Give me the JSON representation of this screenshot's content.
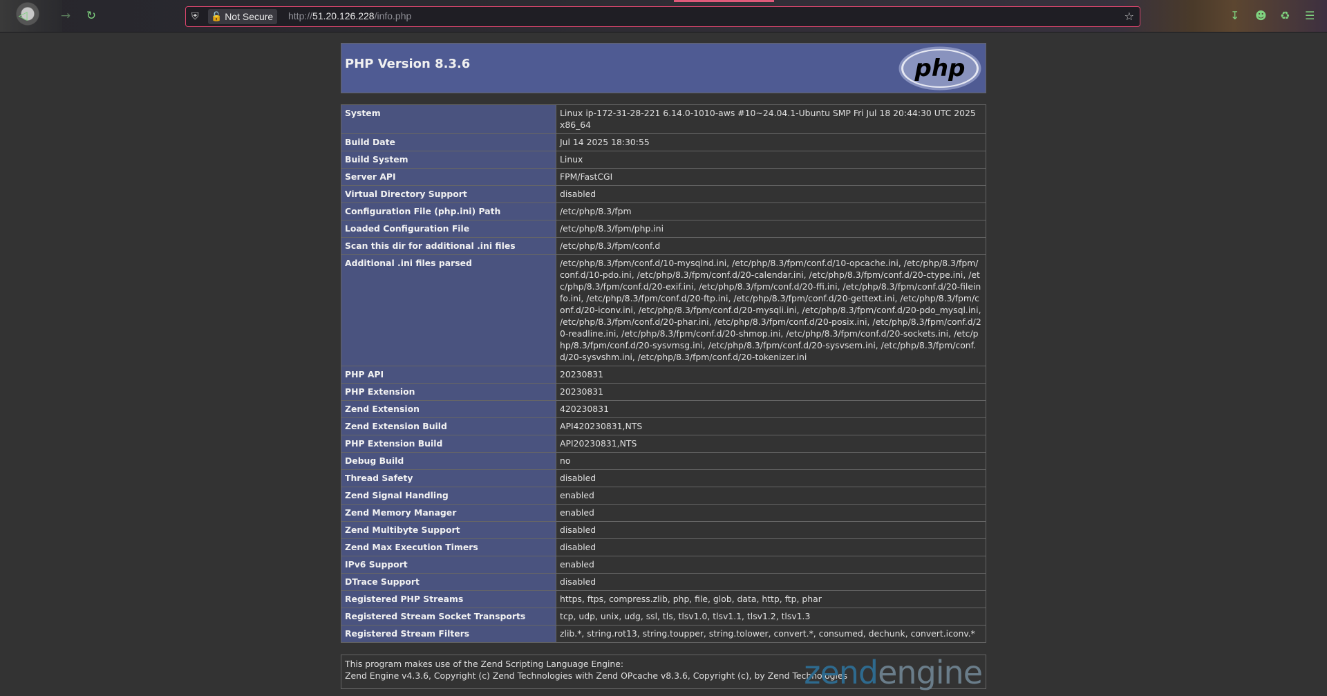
{
  "browser": {
    "security_label": "Not Secure",
    "url_scheme": "http://",
    "url_host": "51.20.126.228",
    "url_path": "/info.php"
  },
  "header": {
    "title": "PHP Version 8.3.6",
    "logo_text": "php"
  },
  "rows": [
    {
      "key": "System",
      "value": "Linux ip-172-31-28-221 6.14.0-1010-aws #10~24.04.1-Ubuntu SMP Fri Jul 18 20:44:30 UTC 2025 x86_64"
    },
    {
      "key": "Build Date",
      "value": "Jul 14 2025 18:30:55"
    },
    {
      "key": "Build System",
      "value": "Linux"
    },
    {
      "key": "Server API",
      "value": "FPM/FastCGI"
    },
    {
      "key": "Virtual Directory Support",
      "value": "disabled"
    },
    {
      "key": "Configuration File (php.ini) Path",
      "value": "/etc/php/8.3/fpm"
    },
    {
      "key": "Loaded Configuration File",
      "value": "/etc/php/8.3/fpm/php.ini"
    },
    {
      "key": "Scan this dir for additional .ini files",
      "value": "/etc/php/8.3/fpm/conf.d"
    },
    {
      "key": "Additional .ini files parsed",
      "value": "/etc/php/8.3/fpm/conf.d/10-mysqlnd.ini, /etc/php/8.3/fpm/conf.d/10-opcache.ini, /etc/php/8.3/fpm/conf.d/10-pdo.ini, /etc/php/8.3/fpm/conf.d/20-calendar.ini, /etc/php/8.3/fpm/conf.d/20-ctype.ini, /etc/php/8.3/fpm/conf.d/20-exif.ini, /etc/php/8.3/fpm/conf.d/20-ffi.ini, /etc/php/8.3/fpm/conf.d/20-fileinfo.ini, /etc/php/8.3/fpm/conf.d/20-ftp.ini, /etc/php/8.3/fpm/conf.d/20-gettext.ini, /etc/php/8.3/fpm/conf.d/20-iconv.ini, /etc/php/8.3/fpm/conf.d/20-mysqli.ini, /etc/php/8.3/fpm/conf.d/20-pdo_mysql.ini, /etc/php/8.3/fpm/conf.d/20-phar.ini, /etc/php/8.3/fpm/conf.d/20-posix.ini, /etc/php/8.3/fpm/conf.d/20-readline.ini, /etc/php/8.3/fpm/conf.d/20-shmop.ini, /etc/php/8.3/fpm/conf.d/20-sockets.ini, /etc/php/8.3/fpm/conf.d/20-sysvmsg.ini, /etc/php/8.3/fpm/conf.d/20-sysvsem.ini, /etc/php/8.3/fpm/conf.d/20-sysvshm.ini, /etc/php/8.3/fpm/conf.d/20-tokenizer.ini"
    },
    {
      "key": "PHP API",
      "value": "20230831"
    },
    {
      "key": "PHP Extension",
      "value": "20230831"
    },
    {
      "key": "Zend Extension",
      "value": "420230831"
    },
    {
      "key": "Zend Extension Build",
      "value": "API420230831,NTS"
    },
    {
      "key": "PHP Extension Build",
      "value": "API20230831,NTS"
    },
    {
      "key": "Debug Build",
      "value": "no"
    },
    {
      "key": "Thread Safety",
      "value": "disabled"
    },
    {
      "key": "Zend Signal Handling",
      "value": "enabled"
    },
    {
      "key": "Zend Memory Manager",
      "value": "enabled"
    },
    {
      "key": "Zend Multibyte Support",
      "value": "disabled"
    },
    {
      "key": "Zend Max Execution Timers",
      "value": "disabled"
    },
    {
      "key": "IPv6 Support",
      "value": "enabled"
    },
    {
      "key": "DTrace Support",
      "value": "disabled"
    },
    {
      "key": "Registered PHP Streams",
      "value": "https, ftps, compress.zlib, php, file, glob, data, http, ftp, phar"
    },
    {
      "key": "Registered Stream Socket Transports",
      "value": "tcp, udp, unix, udg, ssl, tls, tlsv1.0, tlsv1.1, tlsv1.2, tlsv1.3"
    },
    {
      "key": "Registered Stream Filters",
      "value": "zlib.*, string.rot13, string.toupper, string.tolower, convert.*, consumed, dechunk, convert.iconv.*"
    }
  ],
  "footer": {
    "line1": "This program makes use of the Zend Scripting Language Engine:",
    "line2": "Zend Engine v4.3.6, Copyright (c) Zend Technologies with Zend OPcache v8.3.6, Copyright (c), by Zend Technologies",
    "logo_part1": "zend",
    "logo_part2": "engine"
  },
  "colors": {
    "page_bg": "#333333",
    "header_bg": "#4f5b93",
    "key_cell_bg": "#4a537f",
    "url_border": "#d8456c",
    "toolbar_icon": "#7fd37f"
  },
  "icons": [
    "back-arrow-icon",
    "forward-arrow-icon",
    "reload-icon",
    "shield-icon",
    "lock-icon",
    "bookmark-star-icon",
    "download-icon",
    "account-icon",
    "extensions-icon",
    "menu-icon"
  ]
}
